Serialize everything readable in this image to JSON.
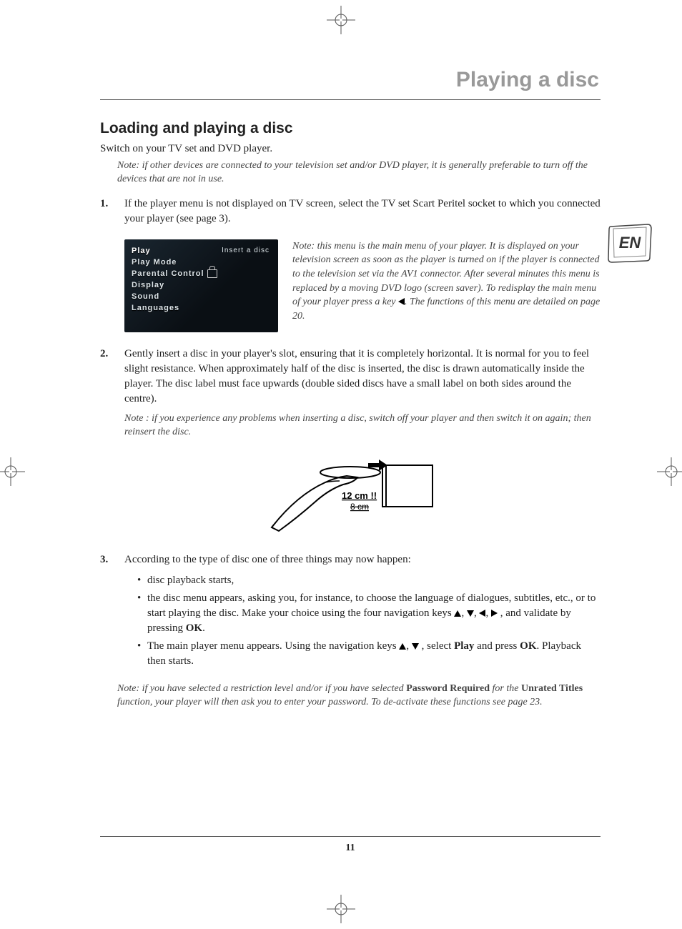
{
  "chapter_title": "Playing a disc",
  "section_title": "Loading and playing a disc",
  "intro": "Switch on your TV set and DVD player.",
  "intro_note": "Note: if other devices are connected to your television set and/or DVD player, it is generally preferable to turn off the devices that are not in use.",
  "steps": {
    "s1": {
      "num": "1.",
      "text": "If the player menu is not displayed on TV screen, select the TV set Scart Peritel socket to which you connected your player (see page 3)."
    },
    "menu": {
      "items": [
        "Play",
        "Play Mode",
        "Parental Control",
        "Display",
        "Sound",
        "Languages"
      ],
      "right_label": "Insert a disc"
    },
    "menu_note_a": "Note: this menu is the main menu of your player. It is displayed on your television screen as soon as the player is turned on if the player is connected to the television set via the AV1 connector. After several minutes this menu is replaced by a moving DVD logo (screen saver). To redisplay the main menu of your player press a key ",
    "menu_note_b": ". The functions of this menu are detailed on page 20.",
    "s2": {
      "num": "2.",
      "text": "Gently insert a disc in your player's slot, ensuring that it is completely horizontal. It is normal for you to feel slight resistance. When approximately half of the disc is inserted, the disc is drawn automatically inside the player. The disc label must face upwards (double sided discs have a small label on both sides around the centre).",
      "note": "Note : if you experience any problems when inserting a disc, switch off your player and then switch it on again; then reinsert the disc."
    },
    "disc_label_ok": "12 cm !!",
    "disc_label_no": "8 cm",
    "s3": {
      "num": "3.",
      "text": "According to the type of disc one of three things may now happen:",
      "b1": "disc playback starts,",
      "b2a": "the disc menu appears, asking you, for instance, to choose the language of dialogues, subtitles, etc., or to start playing the disc. Make your choice using the four navigation keys ",
      "b2b": ", and validate by pressing ",
      "ok": "OK",
      "b3a": "The main player menu appears. Using the navigation keys ",
      "b3b": ", select ",
      "play": "Play",
      "b3c": " and press ",
      "b3d": ". Playback then starts."
    },
    "restriction_a": "Note: if you have selected a restriction level and/or if you have selected ",
    "restriction_pw": "Password Required",
    "restriction_b": " for the ",
    "restriction_ut": "Unrated Titles",
    "restriction_c": " function, your player will then ask you to enter your password. To de-activate these functions see page 23."
  },
  "lang_tab": "EN",
  "page_number": "11"
}
